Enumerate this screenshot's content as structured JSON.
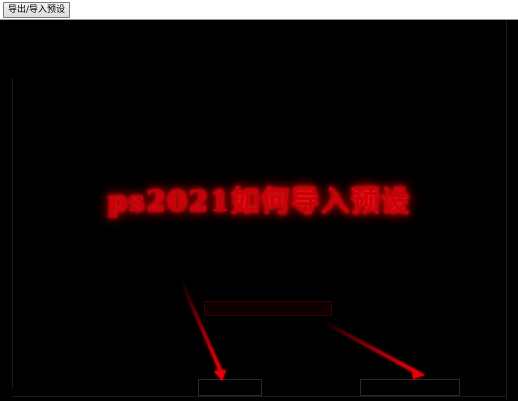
{
  "window": {
    "tab_label": "导出/导入预设"
  },
  "overlay": {
    "headline": "ps2021如何导入预设"
  },
  "colors": {
    "background": "#000000",
    "headline_red": "#c8000a",
    "glow_red": "#ff0000",
    "arrow_red": "#b0000a"
  },
  "icons": {
    "arrow": "red-arrow"
  }
}
